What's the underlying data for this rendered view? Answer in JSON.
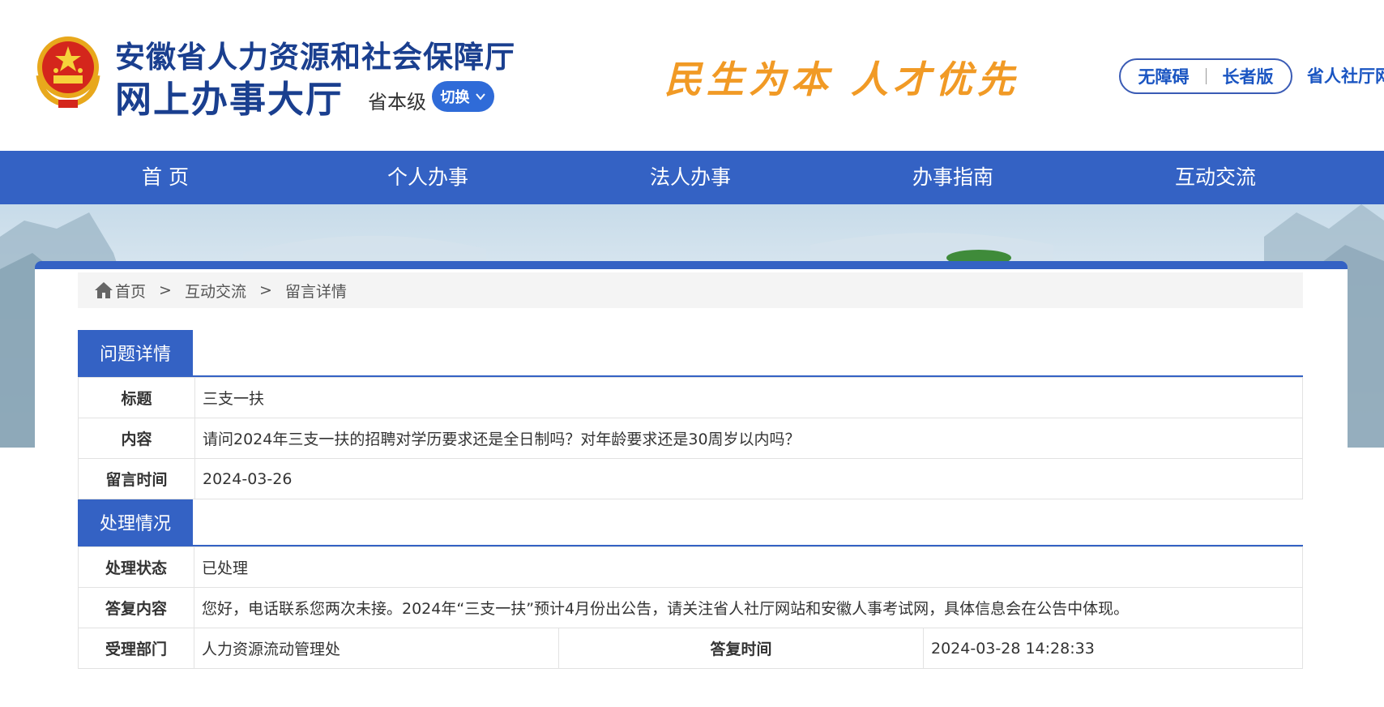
{
  "header": {
    "title": "安徽省人力资源和社会保障厅",
    "subtitle": "网上办事大厅",
    "level": "省本级",
    "switch_label": "切换",
    "slogan": "民生为本 人才优先",
    "accessibility": "无障碍",
    "elder_mode": "长者版",
    "site_link": "省人社厅网"
  },
  "nav": {
    "items": [
      "首 页",
      "个人办事",
      "法人办事",
      "办事指南",
      "互动交流"
    ]
  },
  "breadcrumb": {
    "home": "首页",
    "sep": ">",
    "level2": "互动交流",
    "current": "留言详情"
  },
  "question": {
    "section_title": "问题详情",
    "title_label": "标题",
    "title_value": "三支一扶",
    "content_label": "内容",
    "content_value": "请问2024年三支一扶的招聘对学历要求还是全日制吗？对年龄要求还是30周岁以内吗？",
    "time_label": "留言时间",
    "time_value": "2024-03-26"
  },
  "handling": {
    "section_title": "处理情况",
    "status_label": "处理状态",
    "status_value": "已处理",
    "reply_label": "答复内容",
    "reply_value": "您好，电话联系您两次未接。2024年“三支一扶”预计4月份出公告，请关注省人社厅网站和安徽人事考试网，具体信息会在公告中体现。",
    "dept_label": "受理部门",
    "dept_value": "人力资源流动管理处",
    "reply_time_label": "答复时间",
    "reply_time_value": "2024-03-28 14:28:33"
  },
  "colors": {
    "brand_blue": "#3462c4",
    "title_blue": "#1a3f8f",
    "slogan_orange": "#f19a25"
  }
}
